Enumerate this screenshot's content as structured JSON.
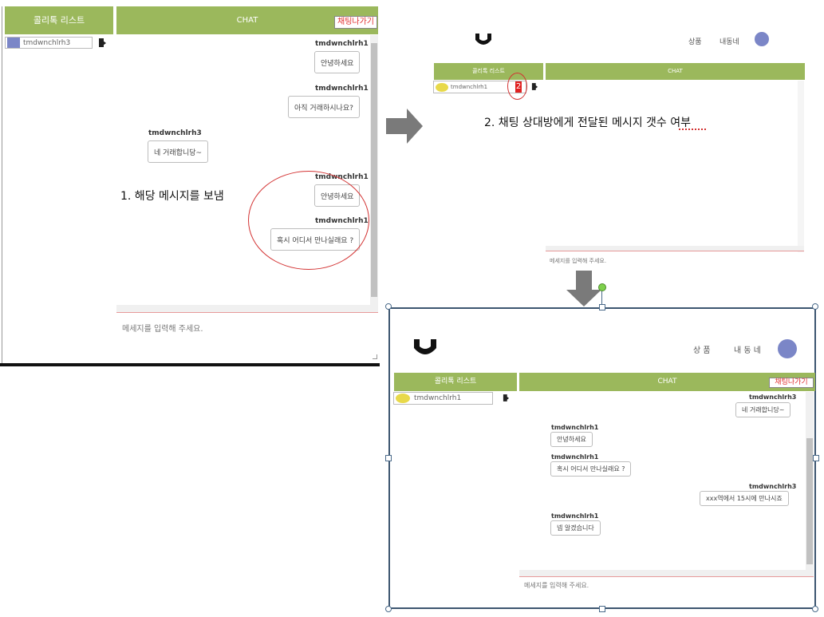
{
  "panel1": {
    "list_title": "콜리톡 리스트",
    "chat_title": "CHAT",
    "exit_chat_button": "채팅나가기",
    "user_item": "tmdwnchlrh3",
    "messages": [
      {
        "sender": "tmdwnchlrh1",
        "text": "안녕하세요"
      },
      {
        "sender": "tmdwnchlrh1",
        "text": "아직 거래하시나요?"
      },
      {
        "sender": "tmdwnchlrh3",
        "text": "네 거래합니당~"
      },
      {
        "sender": "tmdwnchlrh1",
        "text": "안녕하세요"
      },
      {
        "sender": "tmdwnchlrh1",
        "text": "혹시 어디서 만나실래요 ?"
      }
    ],
    "input_placeholder": "메세지를 입력해 주세요."
  },
  "panel2": {
    "nav": {
      "product": "상품",
      "neighborhood": "내동네"
    },
    "list_title": "콜리톡 리스트",
    "chat_title": "CHAT",
    "user_item": "tmdwnchlrh1",
    "unread_count": "2",
    "input_placeholder": "메세지를 입력해 주세요."
  },
  "panel3": {
    "nav": {
      "product": "상 품",
      "neighborhood": "내 동 네"
    },
    "list_title": "콜리톡 리스트",
    "chat_title": "CHAT",
    "exit_chat_button": "채팅나가기",
    "user_item": "tmdwnchlrh1",
    "messages": [
      {
        "sender": "tmdwnchlrh3",
        "text": "네 거래합니당~"
      },
      {
        "sender": "tmdwnchlrh1",
        "text": "안녕하세요"
      },
      {
        "sender": "tmdwnchlrh1",
        "text": "혹시 어디서 만나실래요 ?"
      },
      {
        "sender": "tmdwnchlrh3",
        "text": "xxx역에서 15시에 만나시죠"
      },
      {
        "sender": "tmdwnchlrh1",
        "text": "넵 알겠습니다"
      }
    ],
    "input_placeholder": "메세지를 입력해 주세요."
  },
  "annotations": {
    "step1": "1. 해당 메시지를 보냄",
    "step2": "2. 채팅 상대방에게 전달된 메시지 갯수 여부"
  },
  "colors": {
    "accent_green": "#9bb85c",
    "annotation_red": "#d33333",
    "badge_red": "#e02020"
  }
}
